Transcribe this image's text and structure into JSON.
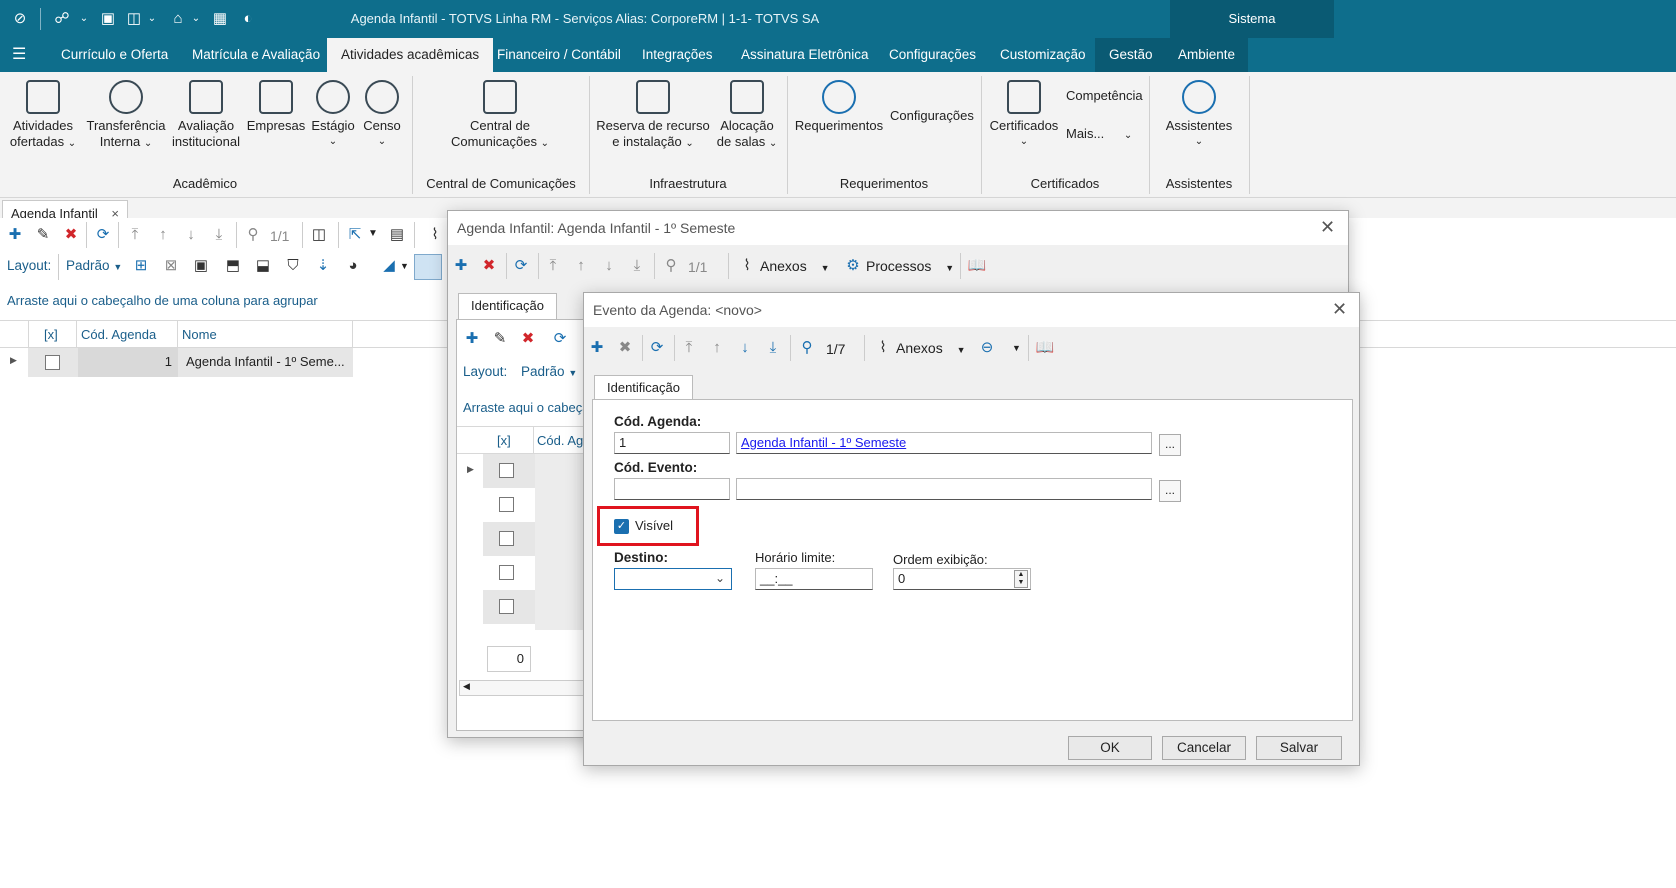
{
  "window": {
    "title": "Agenda Infantil - TOTVS Linha RM - Serviços  Alias: CorporeRM | 1-1- TOTVS SA",
    "sistema": "Sistema"
  },
  "menu": {
    "items": [
      "Currículo e Oferta",
      "Matrícula e Avaliação",
      "Atividades acadêmicas",
      "Financeiro / Contábil",
      "Integrações",
      "Assinatura Eletrônica",
      "Configurações",
      "Customização",
      "Gestão",
      "Ambiente"
    ]
  },
  "ribbon": {
    "academico": {
      "group": "Acadêmico",
      "buttons": [
        {
          "l1": "Atividades",
          "l2": "ofertadas"
        },
        {
          "l1": "Transferência",
          "l2": "Interna"
        },
        {
          "l1": "Avaliação",
          "l2": "institucional"
        },
        {
          "l1": "Empresas",
          "l2": ""
        },
        {
          "l1": "Estágio",
          "l2": ""
        },
        {
          "l1": "Censo",
          "l2": ""
        }
      ]
    },
    "comunicacoes": {
      "group": "Central de Comunicações",
      "l1": "Central de",
      "l2": "Comunicações"
    },
    "infra": {
      "group": "Infraestrutura",
      "b1l1": "Reserva de recurso",
      "b1l2": "e instalação",
      "b2l1": "Alocação",
      "b2l2": "de salas"
    },
    "requerimentos": {
      "group": "Requerimentos",
      "btn": "Requerimentos",
      "config": "Configurações"
    },
    "certificados": {
      "group": "Certificados",
      "btn": "Certificados",
      "competencia": "Competência",
      "mais": "Mais..."
    },
    "assistentes": {
      "group": "Assistentes",
      "btn": "Assistentes"
    }
  },
  "doc_tab": {
    "label": "Agenda Infantil",
    "close": "×"
  },
  "main": {
    "pager": "1/1",
    "layout_label": "Layout:",
    "layout_value": "Padrão",
    "group_hint": "Arraste aqui o cabeçalho de uma coluna para agrupar",
    "columns": [
      "[x]",
      "Cód. Agenda",
      "Nome"
    ],
    "row": {
      "cod": "1",
      "nome": "Agenda Infantil - 1º Seme..."
    }
  },
  "dialog1": {
    "title": "Agenda Infantil: Agenda Infantil - 1º Semeste",
    "pager": "1/1",
    "anexos": "Anexos",
    "processos": "Processos",
    "tab": "Identificação",
    "layout_label": "Layout:",
    "layout_value": "Padrão",
    "group_hint": "Arraste aqui o cabeça",
    "columns": [
      "[x]",
      "Cód. Ag"
    ],
    "footer_count": "0"
  },
  "dialog2": {
    "title": "Evento da Agenda: <novo>",
    "pager": "1/7",
    "anexos": "Anexos",
    "tab": "Identificação",
    "cod_agenda_label": "Cód. Agenda:",
    "cod_agenda_value": "1",
    "agenda_link": "Agenda Infantil - 1º Semeste",
    "cod_evento_label": "Cód. Evento:",
    "visivel_label": "Visível",
    "destino_label": "Destino:",
    "horario_label": "Horário limite:",
    "horario_value": "__:__",
    "ordem_label": "Ordem exibição:",
    "ordem_value": "0",
    "ellipsis": "...",
    "ok": "OK",
    "cancelar": "Cancelar",
    "salvar": "Salvar"
  },
  "colors": {
    "titlebar": "#0e6e8c",
    "highlight": "#e0141e",
    "link": "#1a1aee"
  }
}
